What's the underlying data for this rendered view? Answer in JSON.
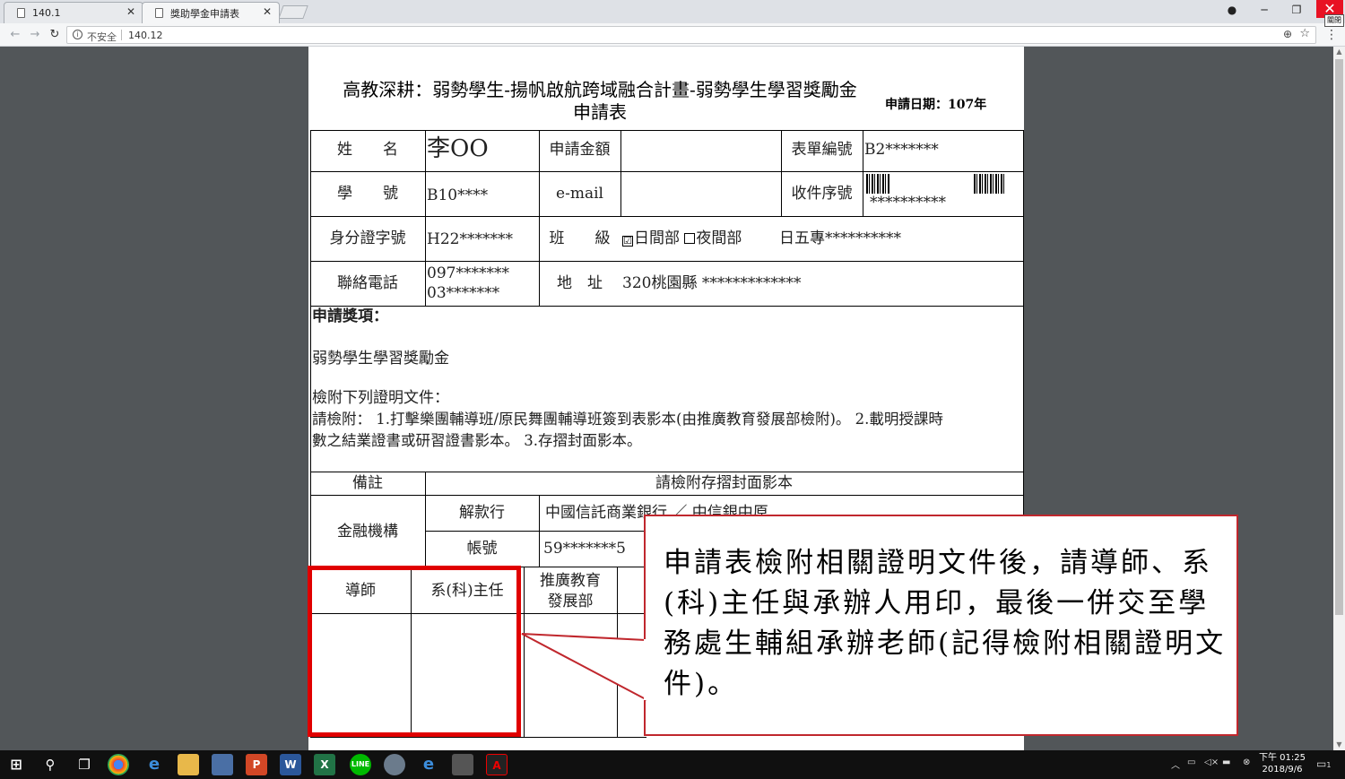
{
  "browser": {
    "tabs": [
      {
        "label": "140.1",
        "active": false
      },
      {
        "label": "獎助學金申請表",
        "active": true
      }
    ],
    "security_label": "不安全",
    "url": "140.12",
    "close_badge": "關閉"
  },
  "form": {
    "title_line1": "高教深耕：弱勢學生-揚帆啟航跨域融合計畫-弱勢學生學習獎勵金",
    "title_line2": "申請表",
    "application_date": "申請日期：107年",
    "labels": {
      "name": "姓　　名",
      "amount": "申請金額",
      "form_no": "表單編號",
      "student_id": "學　　號",
      "email": "e-mail",
      "receipt_no": "收件序號",
      "id_no": "身分證字號",
      "class": "班　　級",
      "phone": "聯絡電話",
      "address": "地　址",
      "award_header": "申請獎項：",
      "remarks": "備註",
      "bank": "金融機構",
      "remit_bank": "解款行",
      "account": "帳號",
      "tutor": "導師",
      "dept_head": "系(科)主任",
      "promo_dept": "推廣教育\n發展部"
    },
    "values": {
      "name": "李OO",
      "amount": "",
      "form_no": "B2*******",
      "student_id": "B10****",
      "email": "",
      "receipt_no": "**********",
      "id_no": "H22*******",
      "day_division": "日間部",
      "day_checked": "☑",
      "night_division": "夜間部",
      "class_name": "日五專**********",
      "phone1": "097*******",
      "phone2": "03*******",
      "address": "320桃園縣 *************",
      "remit_bank": "中國信託商業銀行 ／ 中信銀中原",
      "account": "59*******5"
    },
    "award_name": "弱勢學生學習獎勵金",
    "attachments_header": "檢附下列證明文件：",
    "attachments_line1": "請檢附： 1.打擊樂團輔導班/原民舞團輔導班簽到表影本(由推廣教育發展部檢附)。 2.載明授課時",
    "attachments_line2": "數之結業證書或研習證書影本。 3.存摺封面影本。",
    "remarks_value": "請檢附存摺封面影本"
  },
  "callout": {
    "text": "申請表檢附相關證明文件後，請導師、系(科)主任與承辦人用印，最後一併交至學務處生輔組承辦老師(記得檢附相關證明文件)。",
    "border_color": "#c0272d",
    "highlight_color": "#e00000"
  },
  "taskbar": {
    "time": "下午 01:25",
    "date": "2018/9/6",
    "notification_count": "1"
  }
}
